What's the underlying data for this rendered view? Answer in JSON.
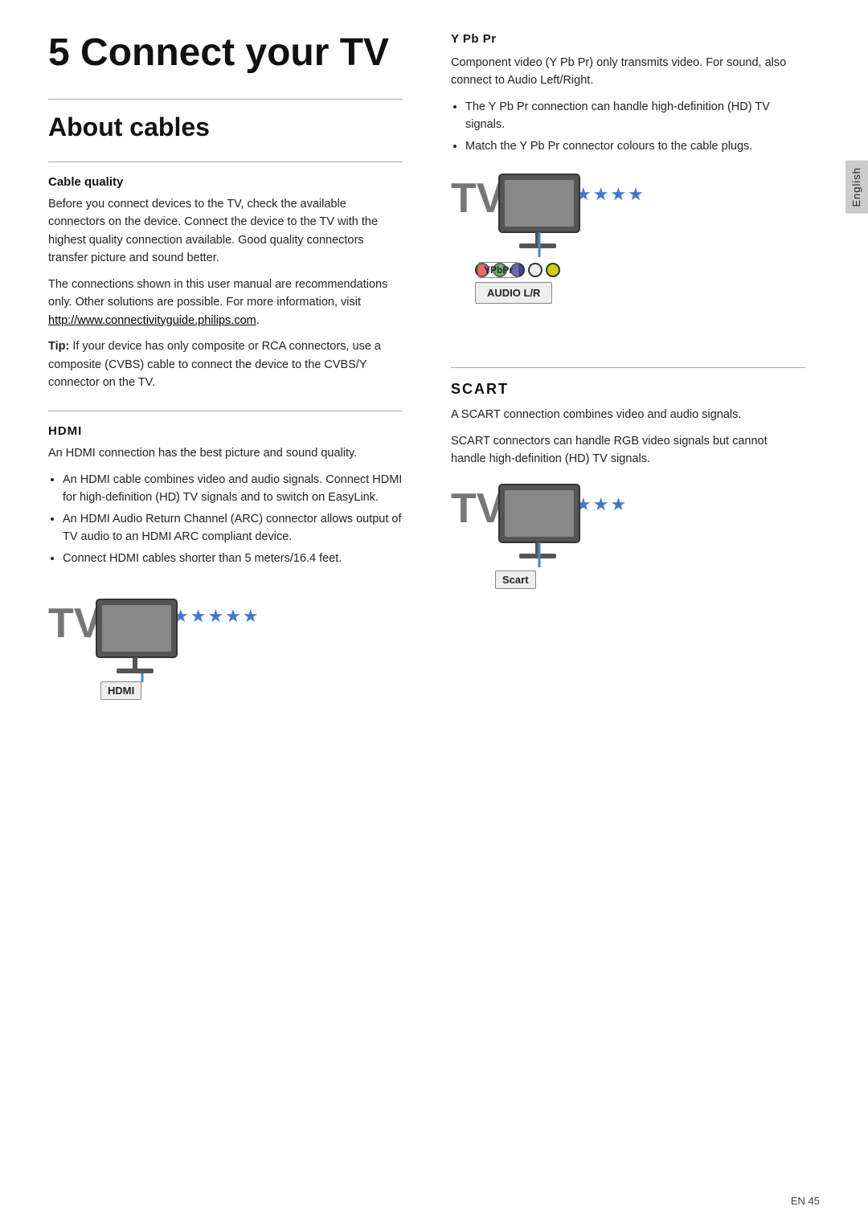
{
  "page": {
    "chapter_number": "5",
    "chapter_title": "Connect your TV",
    "section_about_cables": "About cables",
    "lang_tab": "English",
    "footer_text": "EN    45"
  },
  "cable_quality": {
    "title": "Cable quality",
    "para1": "Before you connect devices to the TV, check the available connectors on the device. Connect the device to the TV with the highest quality connection available. Good quality connectors transfer picture and sound better.",
    "para2": "The connections shown in this user manual are recommendations only. Other solutions are possible. For more information, visit ",
    "link": "http://www.connectivityguide.philips.com",
    "link_end": ".",
    "tip_label": "Tip:",
    "tip_text": " If your device has only composite or RCA connectors, use a composite (CVBS) cable to connect the device to the CVBS/Y connector on the TV."
  },
  "hdmi": {
    "title": "HDMI",
    "para1": "An HDMI connection has the best picture and sound quality.",
    "bullets": [
      "An HDMI cable combines video and audio signals. Connect HDMI for high-definition (HD) TV signals and to switch on EasyLink.",
      "An HDMI Audio Return Channel (ARC) connector allows output of TV audio to an HDMI ARC compliant device.",
      "Connect HDMI cables shorter than 5 meters/16.4 feet."
    ],
    "stars": "★★★★★",
    "tv_label": "TV",
    "connector_label": "HDMI"
  },
  "ypbpr": {
    "title": "Y Pb Pr",
    "para1": "Component video (Y Pb Pr) only transmits video. For sound, also connect to Audio Left/Right.",
    "bullets": [
      "The Y Pb Pr connection can handle high-definition (HD) TV signals.",
      "Match the Y Pb Pr connector colours to the cable plugs."
    ],
    "stars": "★★★★",
    "tv_label": "TV",
    "connector_label_ypbpr": "YPbPr",
    "connector_label_audio": "AUDIO L/R"
  },
  "scart": {
    "title": "SCART",
    "para1": "A SCART connection combines video and audio signals.",
    "para2": "SCART connectors can handle RGB video signals but cannot handle high-definition (HD) TV signals.",
    "stars": "★★★",
    "tv_label": "TV",
    "connector_label": "Scart"
  }
}
